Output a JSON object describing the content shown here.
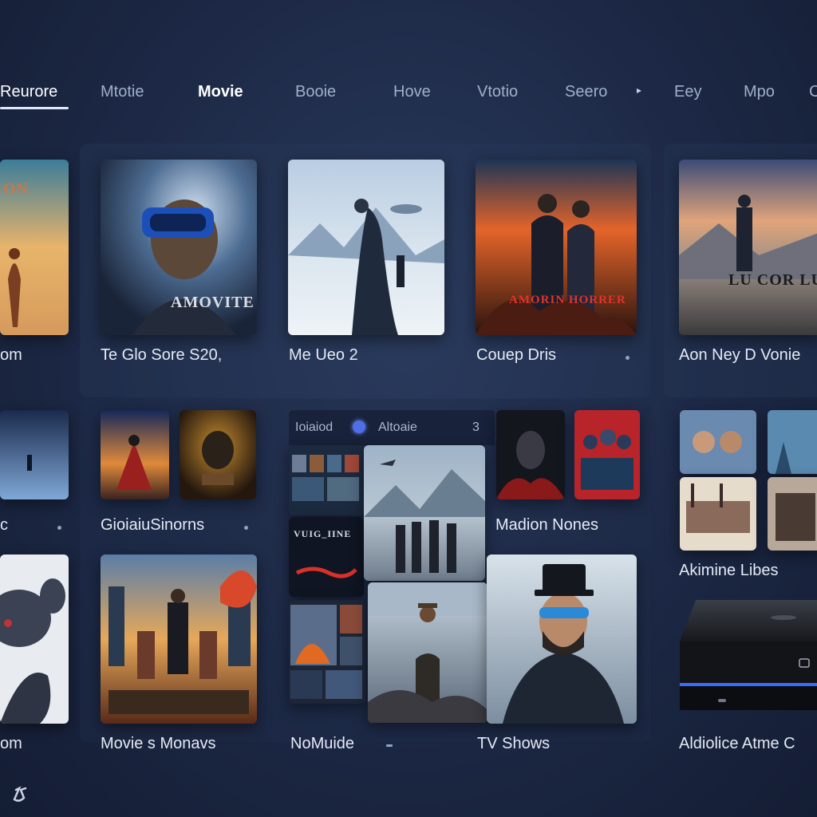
{
  "nav": {
    "items": [
      "Reurore",
      "Mtotie",
      "Movie",
      "Booie",
      "Hove",
      "Vtotio",
      "Seero",
      "Eey",
      "Mpo",
      "C"
    ]
  },
  "rows": {
    "row1": {
      "labels": [
        "om",
        "Te Glo Sore S20,",
        "Me Ueo 2",
        "Couep Dris",
        "Aon Ney D Vonie"
      ],
      "poster_titles": [
        "ON",
        "AMOVITE",
        "AMORIN HORRER",
        "LU COR LU"
      ]
    },
    "row2": {
      "labels": [
        "c",
        "GioiaiuSinorns",
        "Madion Nones",
        "Akimine Libes"
      ],
      "sub_panel": {
        "title": "Ioiaiod",
        "subtitle": "Altoaie",
        "count": "3"
      },
      "poster_title": "VUIG_IINE"
    },
    "row3": {
      "labels": [
        "om",
        "Movie s Monavs",
        "NoMuide",
        "TV Shows",
        "Aldiolice Atme C"
      ]
    }
  },
  "colors": {
    "accent": "#4f6fe8",
    "device_glow": "#3b6cff",
    "background": "#1c2845"
  }
}
